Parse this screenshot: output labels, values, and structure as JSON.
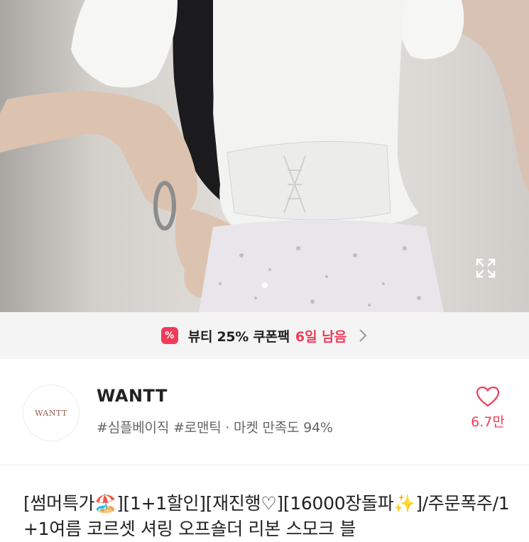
{
  "product_image": {
    "alt_icon": "product-photo"
  },
  "gallery": {
    "expand_icon": "expand-icon"
  },
  "coupon": {
    "icon": "coupon-icon",
    "icon_glyph": "%",
    "text": "뷰티 25% 쿠폰팩",
    "days_left": "6일 남음",
    "chevron_icon": "chevron-right-icon",
    "accent": "#ef3b5a"
  },
  "shop": {
    "logo_text": "WANTT",
    "name": "WANTT",
    "tags": "#심플베이직 #로맨틱 · 마켓 만족도 94%"
  },
  "like": {
    "icon": "heart-icon",
    "count": "6.7만"
  },
  "product": {
    "title": "[썸머특가🏖️][1+1할인][재진행♡][16000장돌파✨]/주문폭주/1+1여름 코르셋 셔링 오프숄더 리본 스모크 블"
  }
}
